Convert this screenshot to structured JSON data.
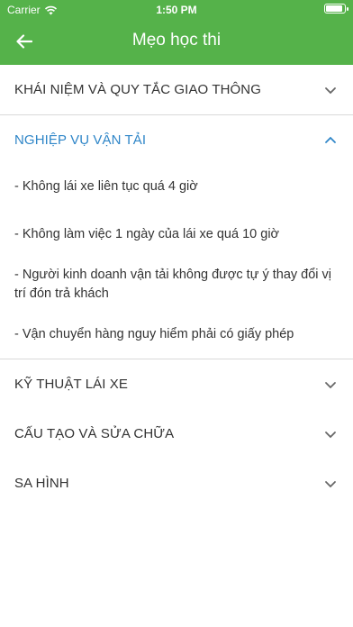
{
  "status": {
    "carrier": "Carrier",
    "time": "1:50 PM"
  },
  "appbar": {
    "title": "Mẹo học thi",
    "back_icon": "arrow-left-icon",
    "color": "#55b24a"
  },
  "sections": [
    {
      "label": "KHÁI NIỆM VÀ QUY TẮC GIAO THÔNG",
      "expanded": false
    },
    {
      "label": "NGHIỆP VỤ VẬN TẢI",
      "expanded": true,
      "items": [
        "- Không lái xe liên tục quá 4 giờ",
        "- Không làm việc 1 ngày của lái xe quá 10 giờ",
        "- Người kinh doanh vận tải không được tự ý thay đổi vị trí đón trả khách",
        "- Vận chuyển hàng nguy hiểm phải có giấy phép"
      ]
    },
    {
      "label": "KỸ THUẬT LÁI XE",
      "expanded": false
    },
    {
      "label": "CẤU TẠO VÀ SỬA CHỮA",
      "expanded": false
    },
    {
      "label": "SA HÌNH",
      "expanded": false
    }
  ],
  "colors": {
    "accent": "#2f86c8",
    "text": "#333333"
  }
}
